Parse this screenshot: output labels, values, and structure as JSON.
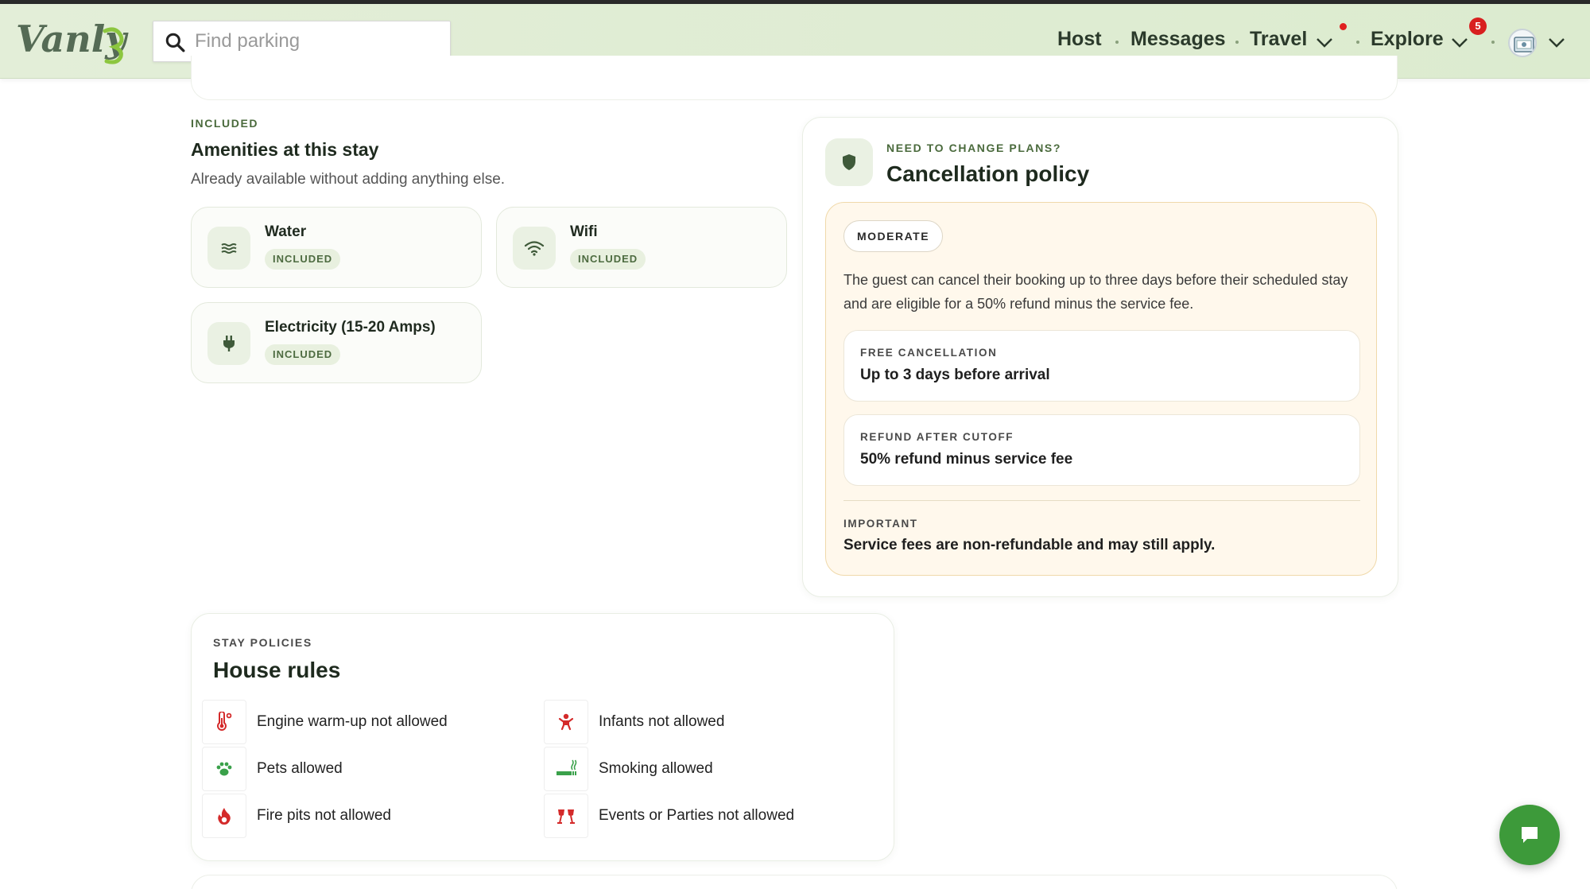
{
  "header": {
    "logo_text": "Vanly",
    "search_placeholder": "Find parking",
    "nav": {
      "host": "Host",
      "messages": "Messages",
      "travel": "Travel",
      "explore": "Explore"
    },
    "explore_badge": "5"
  },
  "amenities": {
    "eyebrow": "INCLUDED",
    "title": "Amenities at this stay",
    "subtitle": "Already available without adding anything else.",
    "items": [
      {
        "name": "Water",
        "badge": "INCLUDED",
        "icon": "water-icon"
      },
      {
        "name": "Wifi",
        "badge": "INCLUDED",
        "icon": "wifi-icon"
      },
      {
        "name": "Electricity (15-20 Amps)",
        "badge": "INCLUDED",
        "icon": "plug-icon"
      }
    ]
  },
  "cancellation": {
    "eyebrow": "NEED TO CHANGE PLANS?",
    "title": "Cancellation policy",
    "level": "MODERATE",
    "description": "The guest can cancel their booking up to three days before their scheduled stay and are eligible for a 50% refund minus the service fee.",
    "free_cancellation": {
      "label": "FREE CANCELLATION",
      "value": "Up to 3 days before arrival"
    },
    "refund_after": {
      "label": "REFUND AFTER CUTOFF",
      "value": "50% refund minus service fee"
    },
    "important": {
      "label": "IMPORTANT",
      "value": "Service fees are non-refundable and may still apply."
    }
  },
  "house_rules": {
    "eyebrow": "STAY POLICIES",
    "title": "House rules",
    "rules": [
      {
        "label": "Engine warm-up not allowed",
        "icon": "thermometer-icon",
        "allowed": false
      },
      {
        "label": "Infants not allowed",
        "icon": "baby-icon",
        "allowed": false
      },
      {
        "label": "Pets allowed",
        "icon": "paw-icon",
        "allowed": true
      },
      {
        "label": "Smoking allowed",
        "icon": "smoking-icon",
        "allowed": true
      },
      {
        "label": "Fire pits not allowed",
        "icon": "fire-icon",
        "allowed": false
      },
      {
        "label": "Events or Parties not allowed",
        "icon": "party-icon",
        "allowed": false
      }
    ]
  },
  "colors": {
    "accent_green": "#3d9a3a",
    "header_bg": "#dcebcf",
    "not_allowed_red": "#d42a2a",
    "allowed_green": "#3aa14a",
    "policy_bg": "#fff8ec"
  }
}
